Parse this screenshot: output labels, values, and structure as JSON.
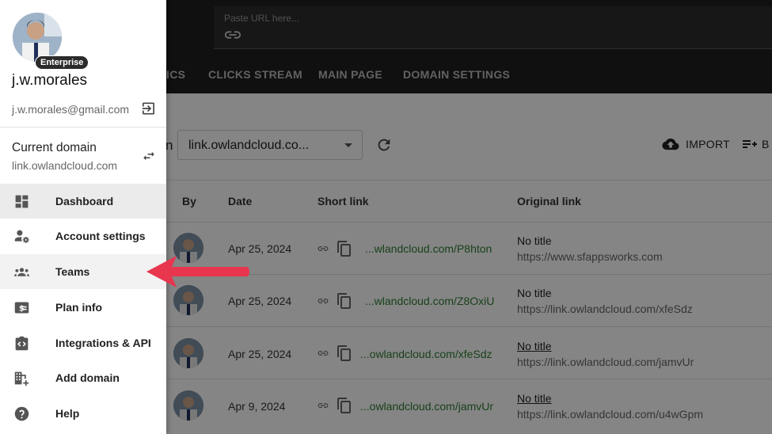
{
  "topbar": {
    "url_placeholder": "Paste URL here...",
    "tabs": [
      "ICS",
      "CLICKS STREAM",
      "MAIN PAGE",
      "DOMAIN SETTINGS"
    ]
  },
  "toolbar": {
    "partial_heading": "n",
    "domain_value": "link.owlandcloud.co...",
    "import_label": "IMPORT",
    "b_label": "B"
  },
  "table": {
    "headers": {
      "by": "By",
      "date": "Date",
      "short": "Short link",
      "original": "Original link"
    },
    "rows": [
      {
        "date": "Apr 25, 2024",
        "short": "...wlandcloud.com/P8hton",
        "title": "No title",
        "original": "https://www.sfappsworks.com"
      },
      {
        "date": "Apr 25, 2024",
        "short": "...wlandcloud.com/Z8OxiU",
        "title": "No title",
        "original": "https://link.owlandcloud.com/xfeSdz"
      },
      {
        "date": "Apr 25, 2024",
        "short": "...owlandcloud.com/xfeSdz",
        "title": "No title",
        "original": "https://link.owlandcloud.com/jamvUr"
      },
      {
        "date": "Apr 9, 2024",
        "short": "...owlandcloud.com/jamvUr",
        "title": "No title",
        "original": "https://link.owlandcloud.com/u4wGpm"
      }
    ]
  },
  "drawer": {
    "plan_badge": "Enterprise",
    "username": "j.w.morales",
    "email": "j.w.morales@gmail.com",
    "current_domain_label": "Current domain",
    "current_domain_value": "link.owlandcloud.com",
    "menu": [
      {
        "label": "Dashboard",
        "icon": "dashboard-icon"
      },
      {
        "label": "Account settings",
        "icon": "account-settings-icon"
      },
      {
        "label": "Teams",
        "icon": "teams-icon"
      },
      {
        "label": "Plan info",
        "icon": "plan-info-icon"
      },
      {
        "label": "Integrations & API",
        "icon": "integrations-icon"
      },
      {
        "label": "Add domain",
        "icon": "add-domain-icon"
      },
      {
        "label": "Help",
        "icon": "help-icon"
      }
    ]
  },
  "colors": {
    "accent_arrow": "#e8364f",
    "short_link": "#2e7d32",
    "topbar": "#1f1f1f"
  }
}
